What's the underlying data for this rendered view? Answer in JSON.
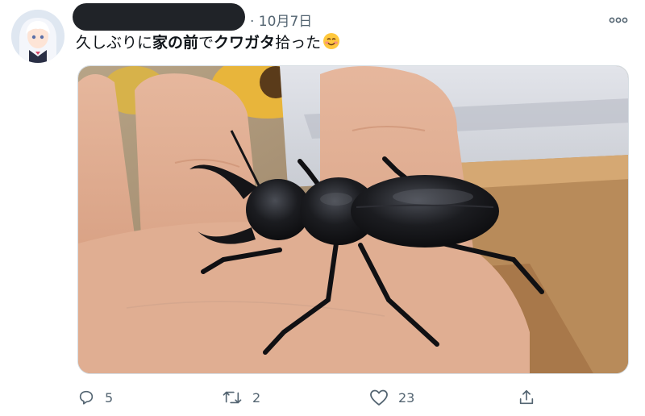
{
  "tweet": {
    "date_label": "· 10月7日",
    "more_icon": "more-icon",
    "text": {
      "p1": "久しぶりに",
      "b1": "家の前",
      "p2": "で",
      "b2": "クワガタ",
      "p3": "拾った",
      "emoji": "☺"
    },
    "image_icon": "stag-beetle-photo"
  },
  "actions": {
    "reply": {
      "icon": "reply-icon",
      "count": "5"
    },
    "retweet": {
      "icon": "retweet-icon",
      "count": "2"
    },
    "like": {
      "icon": "heart-icon",
      "count": "23"
    },
    "share": {
      "icon": "share-icon"
    }
  },
  "colors": {
    "secondary_text": "#536471",
    "primary_text": "#0f1419"
  }
}
